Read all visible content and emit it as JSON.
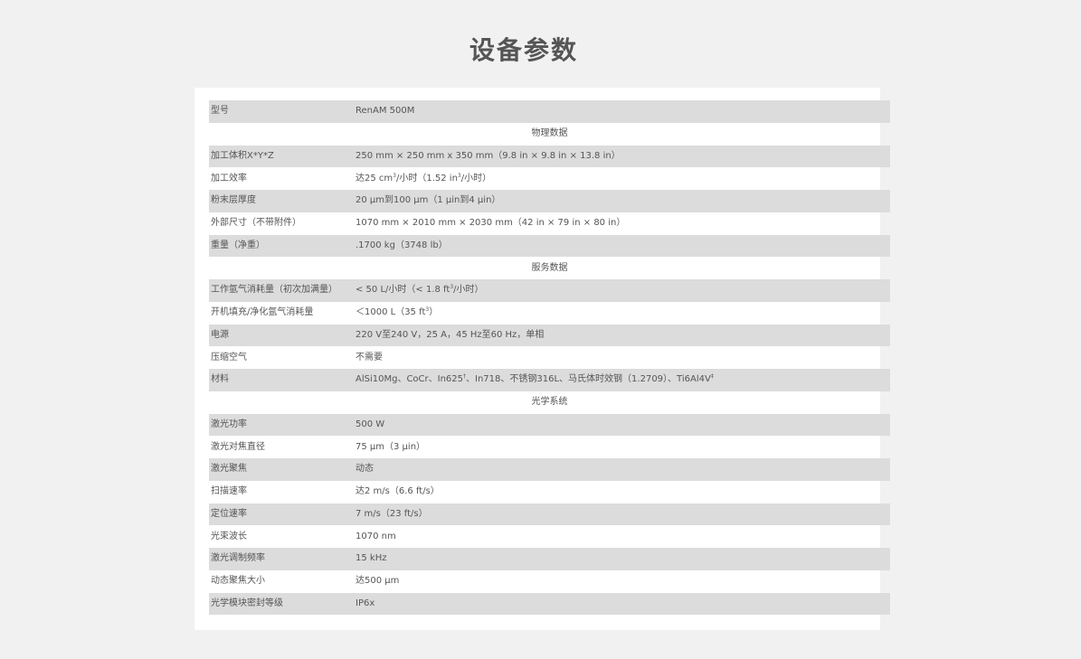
{
  "page": {
    "title": "设备参数"
  },
  "specs": {
    "model_label": "型号",
    "model_value": "RenAM 500M",
    "section_physical": "物理数据",
    "build_volume_label": "加工体积X*Y*Z",
    "build_volume_value": "250 mm × 250 mm x 350 mm（9.8 in × 9.8 in × 13.8 in）",
    "build_rate_label": "加工效率",
    "build_rate_value_a": "达25 cm",
    "build_rate_sup_a": "3",
    "build_rate_value_b": "/小时（1.52 in",
    "build_rate_sup_b": "3",
    "build_rate_value_c": "/小时）",
    "layer_label": "粉末层厚度",
    "layer_value": "20 µm到100 µm（1 µin到4 µin）",
    "dims_label": "外部尺寸（不带附件）",
    "dims_value": "1070 mm × 2010 mm × 2030 mm（42 in × 79 in × 80 in）",
    "weight_label": "重量（净重）",
    "weight_value": ".1700 kg（3748 lb）",
    "section_service": "服务数据",
    "argon_label": "工作氩气消耗量（初次加满量）",
    "argon_value_a": "< 50 L/小时（< 1.8 ft",
    "argon_sup": "3",
    "argon_value_b": "/小时）",
    "purge_label": "开机填充/净化氩气消耗量",
    "purge_value_a": "＜1000 L（35 ft",
    "purge_sup": "3",
    "purge_value_b": "）",
    "power_label": "电源",
    "power_value": "220 V至240 V，25 A，45 Hz至60 Hz，单相",
    "air_label": "压缩空气",
    "air_value": "不需要",
    "materials_label": "材料",
    "materials_value_a": "AlSi10Mg、CoCr、In625",
    "materials_sup_a": "†",
    "materials_value_b": "、In718、不锈钢316L、马氏体时效钢（1.2709）、Ti6Al4V",
    "materials_sup_b": "‡",
    "section_optics": "光学系统",
    "laser_power_label": "激光功率",
    "laser_power_value": "500 W",
    "spot_label": "激光对焦直径",
    "spot_value": "75 µm（3 µin）",
    "focus_label": "激光聚焦",
    "focus_value": "动态",
    "scan_speed_label": "扫描速率",
    "scan_speed_value": "达2 m/s（6.6 ft/s）",
    "position_speed_label": "定位速率",
    "position_speed_value": "7 m/s（23 ft/s）",
    "wavelength_label": "光束波长",
    "wavelength_value": "1070 nm",
    "modulation_label": "激光调制频率",
    "modulation_value": "15 kHz",
    "focus_size_label": "动态聚焦大小",
    "focus_size_value": "达500 µm",
    "seal_label": "光学模块密封等级",
    "seal_value": "IP6x"
  }
}
